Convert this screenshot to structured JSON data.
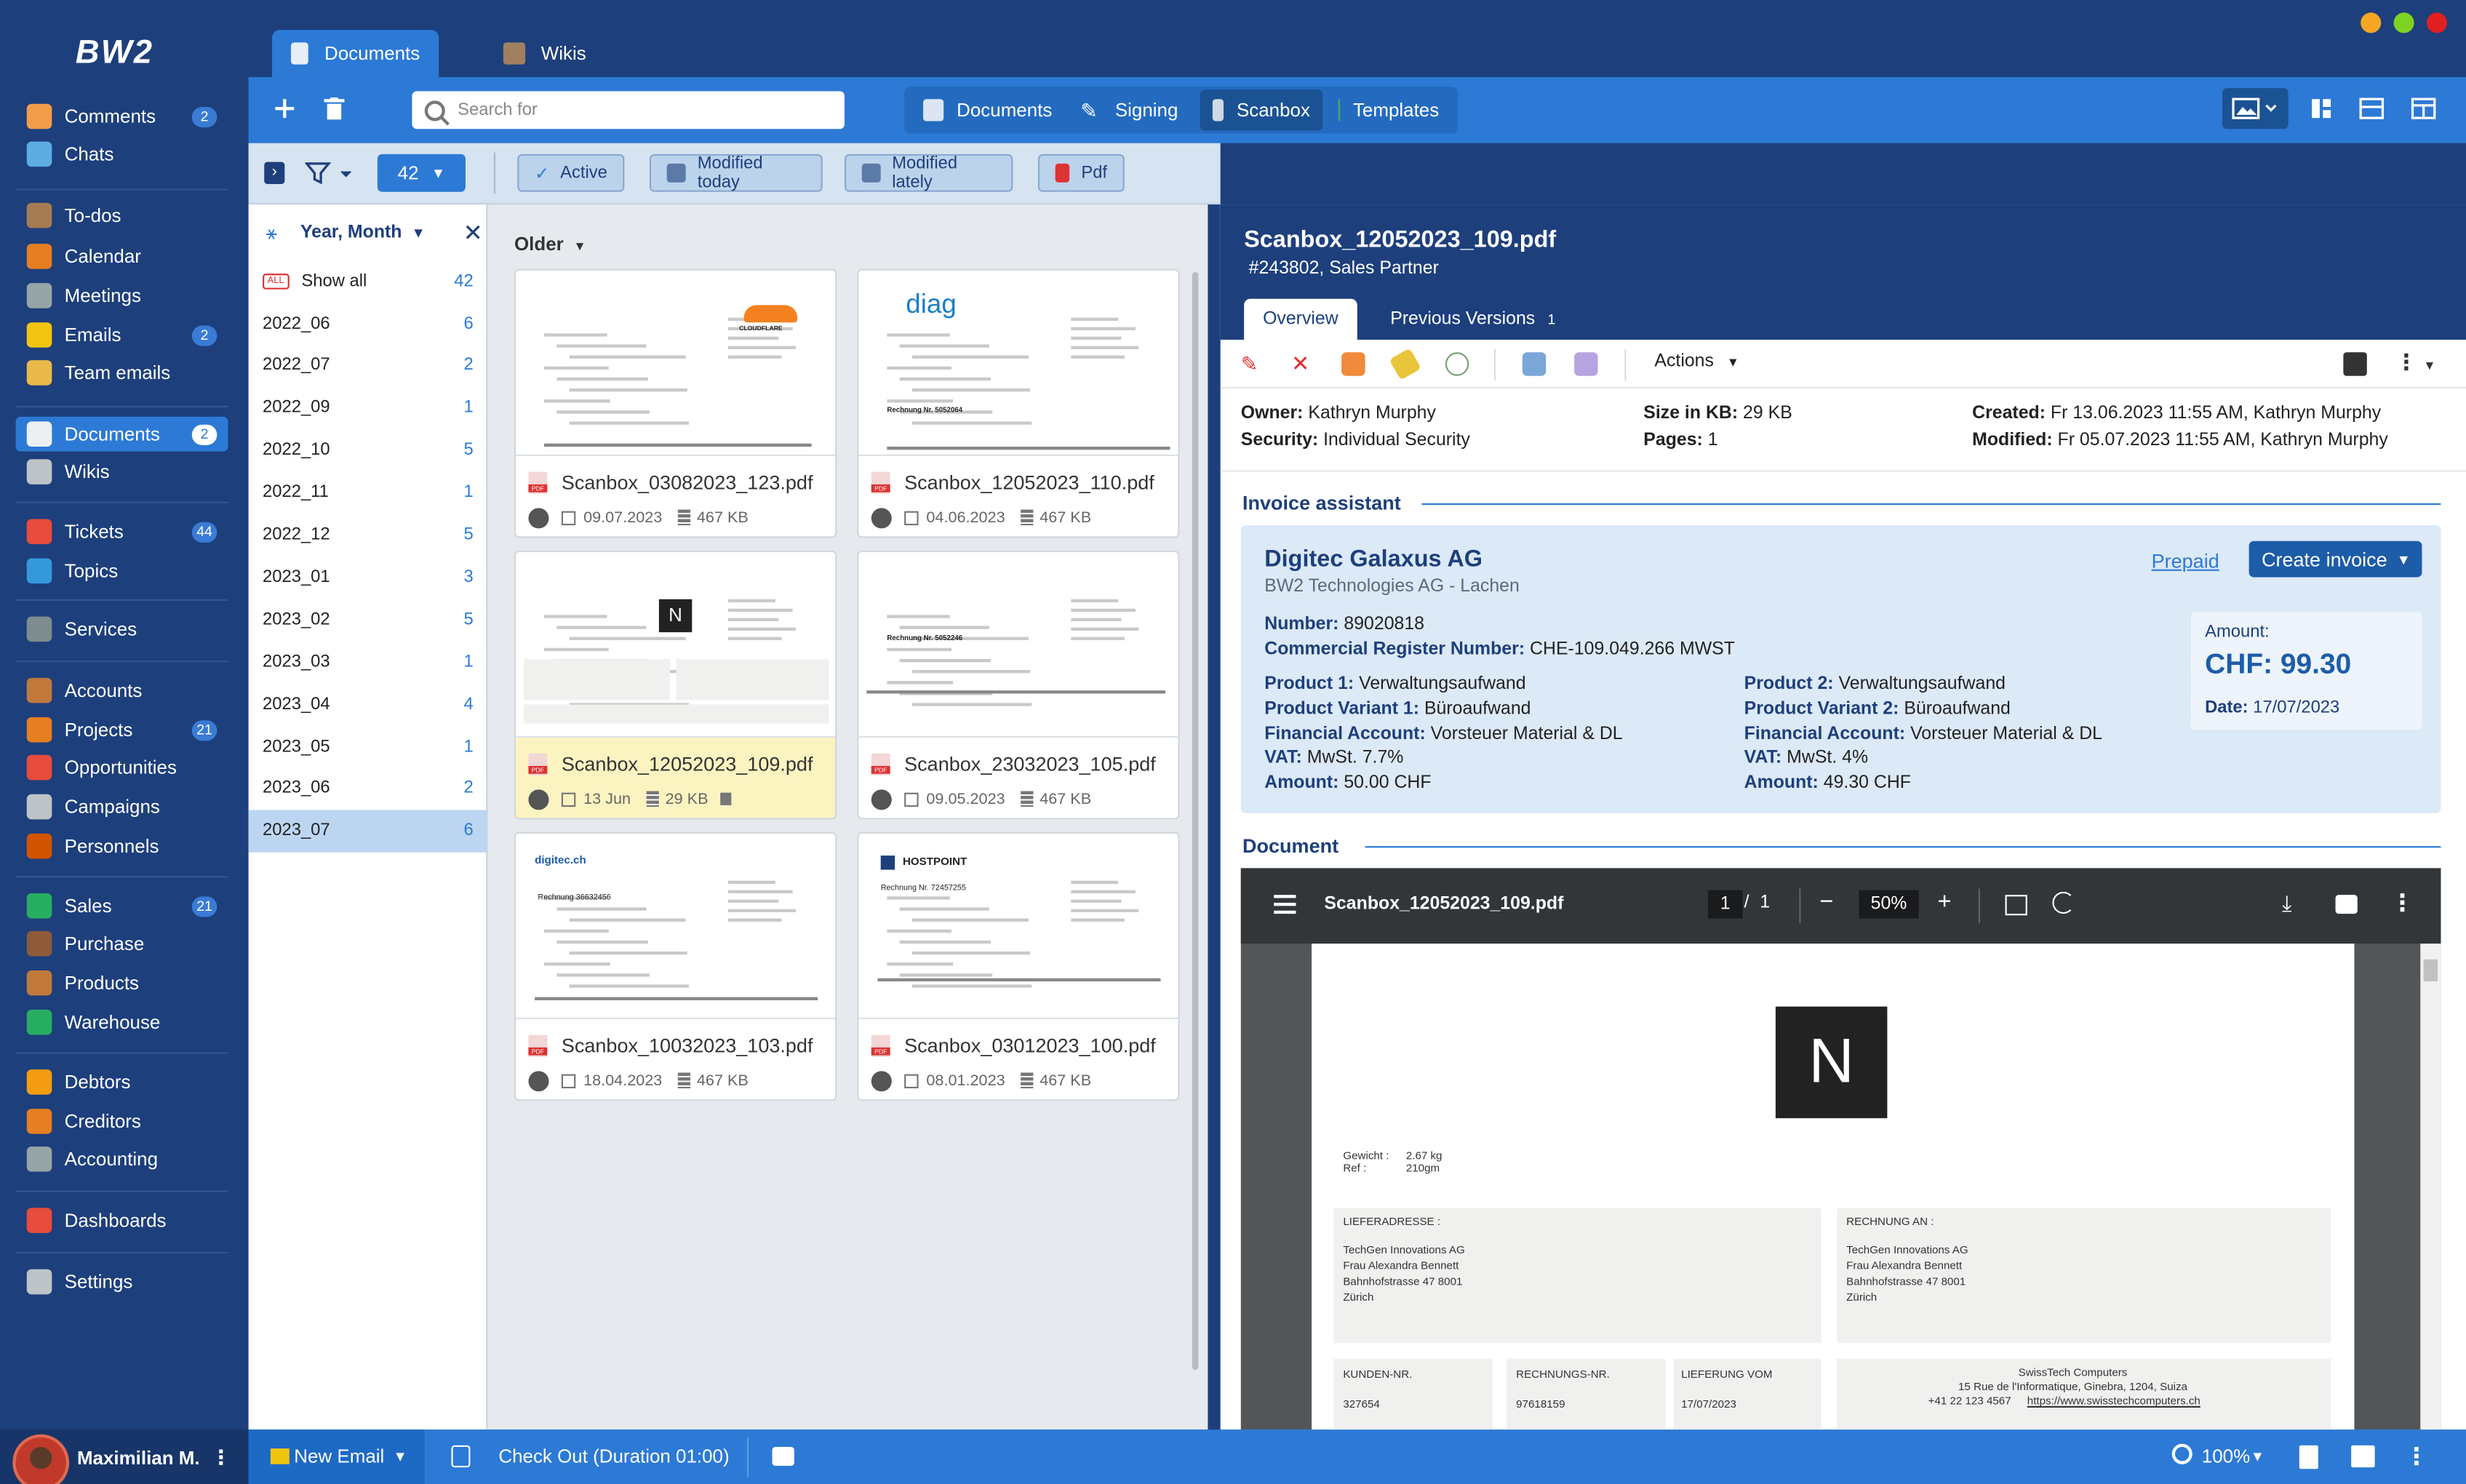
{
  "app": {
    "logo": "BW2"
  },
  "sidebar": {
    "items": [
      {
        "label": "Comments",
        "badge": "2",
        "icon": "comments-icon",
        "color": "#f39c4a"
      },
      {
        "label": "Chats",
        "badge": "",
        "icon": "chats-icon",
        "color": "#5dade2"
      },
      {
        "label": "To-dos",
        "badge": "",
        "icon": "todos-icon",
        "color": "#a67c52"
      },
      {
        "label": "Calendar",
        "badge": "",
        "icon": "calendar-icon",
        "color": "#e67e22"
      },
      {
        "label": "Meetings",
        "badge": "",
        "icon": "meetings-icon",
        "color": "#95a5a6"
      },
      {
        "label": "Emails",
        "badge": "2",
        "icon": "emails-icon",
        "color": "#f1c40f"
      },
      {
        "label": "Team emails",
        "badge": "",
        "icon": "team-emails-icon",
        "color": "#e9b949"
      },
      {
        "label": "Documents",
        "badge": "2",
        "icon": "documents-icon",
        "color": "#ecf0f1"
      },
      {
        "label": "Wikis",
        "badge": "",
        "icon": "wikis-icon",
        "color": "#bdc3c7"
      },
      {
        "label": "Tickets",
        "badge": "44",
        "icon": "tickets-icon",
        "color": "#e74c3c"
      },
      {
        "label": "Topics",
        "badge": "",
        "icon": "topics-icon",
        "color": "#3498db"
      },
      {
        "label": "Services",
        "badge": "",
        "icon": "services-icon",
        "color": "#7f8c8d"
      },
      {
        "label": "Accounts",
        "badge": "",
        "icon": "accounts-icon",
        "color": "#c0793b"
      },
      {
        "label": "Projects",
        "badge": "21",
        "icon": "projects-icon",
        "color": "#e67e22"
      },
      {
        "label": "Opportunities",
        "badge": "",
        "icon": "opportunities-icon",
        "color": "#e74c3c"
      },
      {
        "label": "Campaigns",
        "badge": "",
        "icon": "campaigns-icon",
        "color": "#bdc3c7"
      },
      {
        "label": "Personnels",
        "badge": "",
        "icon": "personnels-icon",
        "color": "#d35400"
      },
      {
        "label": "Sales",
        "badge": "21",
        "icon": "sales-icon",
        "color": "#27ae60"
      },
      {
        "label": "Purchase",
        "badge": "",
        "icon": "purchase-icon",
        "color": "#8e5a3a"
      },
      {
        "label": "Products",
        "badge": "",
        "icon": "products-icon",
        "color": "#c0793b"
      },
      {
        "label": "Warehouse",
        "badge": "",
        "icon": "warehouse-icon",
        "color": "#27ae60"
      },
      {
        "label": "Debtors",
        "badge": "",
        "icon": "debtors-icon",
        "color": "#f39c12"
      },
      {
        "label": "Creditors",
        "badge": "",
        "icon": "creditors-icon",
        "color": "#e67e22"
      },
      {
        "label": "Accounting",
        "badge": "",
        "icon": "accounting-icon",
        "color": "#95a5a6"
      },
      {
        "label": "Dashboards",
        "badge": "",
        "icon": "dashboards-icon",
        "color": "#e74c3c"
      },
      {
        "label": "Settings",
        "badge": "",
        "icon": "settings-icon",
        "color": "#bdc3c7"
      }
    ],
    "user": {
      "name": "Maximilian M."
    }
  },
  "tabs": [
    {
      "label": "Documents"
    },
    {
      "label": "Wikis"
    }
  ],
  "toolbar": {
    "search_placeholder": "Search for",
    "modes": [
      {
        "label": "Documents"
      },
      {
        "label": "Signing"
      },
      {
        "label": "Scanbox"
      },
      {
        "label": "Templates"
      }
    ]
  },
  "filters": {
    "count": "42",
    "chips": [
      {
        "label": "Active"
      },
      {
        "label": "Modified today"
      },
      {
        "label": "Modified lately"
      },
      {
        "label": "Pdf"
      }
    ]
  },
  "groups": {
    "header": "Year, Month",
    "show_all": "Show all",
    "show_all_tag": "ALL",
    "show_all_count": "42",
    "rows": [
      {
        "label": "2022_06",
        "count": "6"
      },
      {
        "label": "2022_07",
        "count": "2"
      },
      {
        "label": "2022_09",
        "count": "1"
      },
      {
        "label": "2022_10",
        "count": "5"
      },
      {
        "label": "2022_11",
        "count": "1"
      },
      {
        "label": "2022_12",
        "count": "5"
      },
      {
        "label": "2023_01",
        "count": "3"
      },
      {
        "label": "2023_02",
        "count": "5"
      },
      {
        "label": "2023_03",
        "count": "1"
      },
      {
        "label": "2023_04",
        "count": "4"
      },
      {
        "label": "2023_05",
        "count": "1"
      },
      {
        "label": "2023_06",
        "count": "2"
      },
      {
        "label": "2023_07",
        "count": "6"
      }
    ]
  },
  "cards": {
    "section": "Older",
    "items": [
      {
        "name": "Scanbox_03082023_123.pdf",
        "date": "09.07.2023",
        "size": "467 KB",
        "thumb_brand": "CLOUDFLARE"
      },
      {
        "name": "Scanbox_12052023_110.pdf",
        "date": "04.06.2023",
        "size": "467 KB",
        "thumb_brand": "diag",
        "thumb_title": "Rechnung Nr. 5052064"
      },
      {
        "name": "Scanbox_12052023_109.pdf",
        "date": "13 Jun",
        "size": "29 KB",
        "thumb_brand": "N"
      },
      {
        "name": "Scanbox_23032023_105.pdf",
        "date": "09.05.2023",
        "size": "467 KB",
        "thumb_title": "Rechnung Nr. 5052246"
      },
      {
        "name": "Scanbox_10032023_103.pdf",
        "date": "18.04.2023",
        "size": "467 KB",
        "thumb_brand": "digitec.ch",
        "thumb_title": "Rechnung 36632456"
      },
      {
        "name": "Scanbox_03012023_100.pdf",
        "date": "08.01.2023",
        "size": "467 KB",
        "thumb_brand": "HOSTPOINT",
        "thumb_title": "Rechnung Nr. 72457255"
      }
    ]
  },
  "detail": {
    "title": "Scanbox_12052023_109.pdf",
    "subtitle": "#243802, Sales Partner",
    "tabs": [
      {
        "label": "Overview"
      },
      {
        "label": "Previous Versions",
        "count": "1"
      }
    ],
    "actions_label": "Actions",
    "props": {
      "owner_label": "Owner:",
      "owner": "Kathryn Murphy",
      "security_label": "Security:",
      "security": "Individual Security",
      "size_label": "Size in KB:",
      "size": "29 KB",
      "pages_label": "Pages:",
      "pages": "1",
      "created_label": "Created:",
      "created": "Fr 13.06.2023 11:55 AM, Kathryn Murphy",
      "modified_label": "Modified:",
      "modified": "Fr 05.07.2023 11:55 AM, Kathryn Murphy"
    },
    "invoice": {
      "section": "Invoice assistant",
      "vendor": "Digitec Galaxus AG",
      "vendor_sub": "BW2 Technologies AG - Lachen",
      "prepaid": "Prepaid",
      "create": "Create invoice",
      "number_label": "Number:",
      "number": "89020818",
      "crn_label": "Commercial Register Number:",
      "crn": "CHE-109.049.266 MWST",
      "p1": {
        "product_label": "Product 1:",
        "product": "Verwaltungsaufwand",
        "variant_label": "Product Variant 1:",
        "variant": "Büroaufwand",
        "account_label": "Financial Account:",
        "account": "Vorsteuer Material & DL",
        "vat_label": "VAT:",
        "vat": "MwSt. 7.7%",
        "amount_label": "Amount:",
        "amount": "50.00 CHF"
      },
      "p2": {
        "product_label": "Product 2:",
        "product": "Verwaltungsaufwand",
        "variant_label": "Product Variant 2:",
        "variant": "Büroaufwand",
        "account_label": "Financial Account:",
        "account": "Vorsteuer Material & DL",
        "vat_label": "VAT:",
        "vat": "MwSt. 4%",
        "amount_label": "Amount:",
        "amount": "49.30 CHF"
      },
      "amount_caption": "Amount:",
      "amount_total": "CHF: 99.30",
      "date_label": "Date:",
      "date": "17/07/2023"
    },
    "document": {
      "section": "Document",
      "viewer_title": "Scanbox_12052023_109.pdf",
      "page_current": "1",
      "page_sep": "/",
      "page_total": "1",
      "zoom": "50%",
      "logo_letter": "N",
      "weight_label": "Gewicht :",
      "weight": "2.67 kg",
      "ref_label": "Ref :",
      "ref": "210gm",
      "delivery_label": "LIEFERADRESSE :",
      "delivery_lines": [
        "TechGen Innovations AG",
        "Frau Alexandra Bennett",
        "Bahnhofstrasse 47 8001",
        "Zürich"
      ],
      "billing_label": "RECHNUNG AN :",
      "billing_lines": [
        "TechGen Innovations AG",
        "Frau Alexandra Bennett",
        "Bahnhofstrasse 47 8001",
        "Zürich"
      ],
      "kunden_label": "KUNDEN-NR.",
      "kunden": "327654",
      "rechnungs_label": "RECHNUNGS-NR.",
      "rechnungs": "97618159",
      "lieferung_label": "LIEFERUNG VOM",
      "lieferung": "17/07/2023",
      "company_lines": [
        "SwissTech Computers",
        "15 Rue de l'Informatique, Ginebra, 1204, Suiza",
        "+41 22 123 4567"
      ],
      "company_url": "https://www.swisstechcomputers.ch"
    }
  },
  "bottombar": {
    "new_email": "New Email",
    "checkout": "Check Out (Duration 01:00)",
    "zoom": "100%"
  },
  "colors": {
    "brand": "#1d3f7c",
    "accent": "#2c7ad6",
    "selection": "#fbf4c1"
  }
}
